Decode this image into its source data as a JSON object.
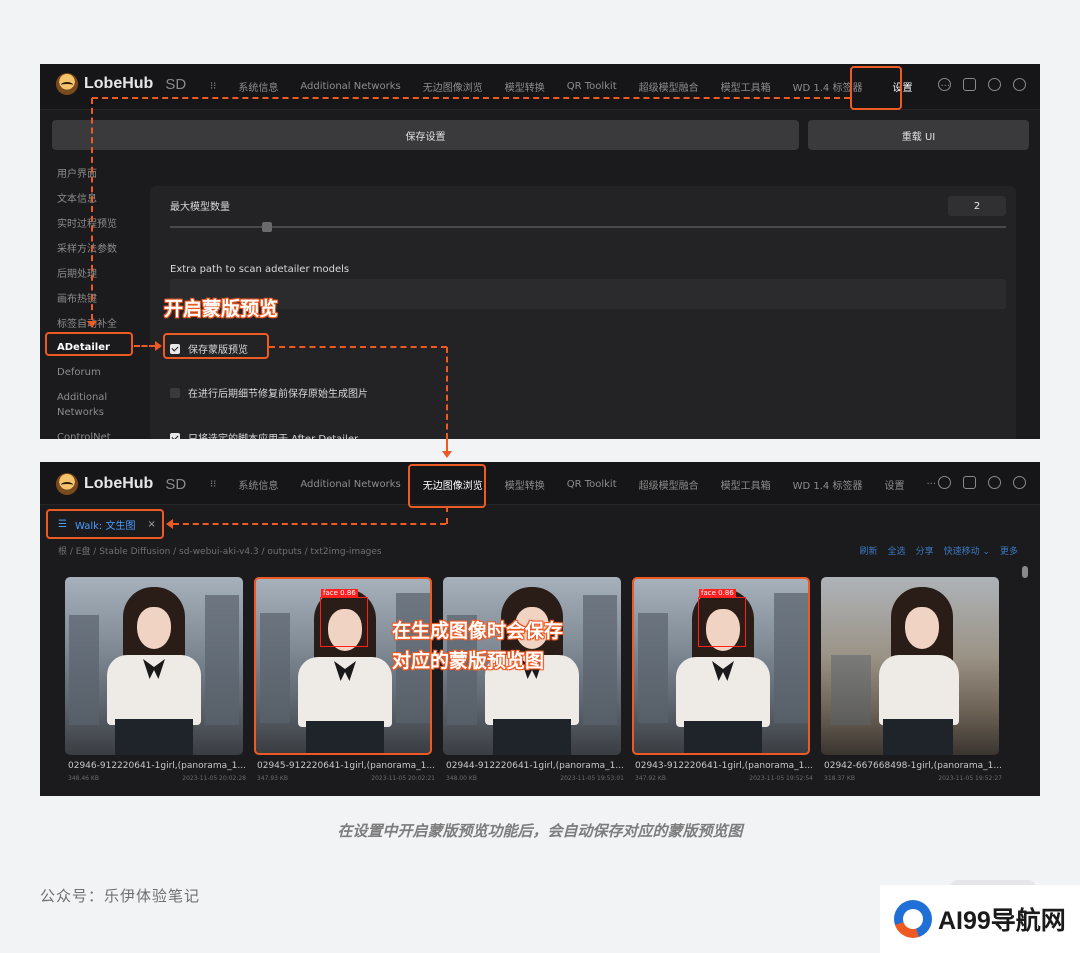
{
  "app": {
    "brand": "LobeHub",
    "brand_suffix": "SD"
  },
  "shot1": {
    "nav_tabs": [
      "⁝⁝",
      "系统信息",
      "Additional Networks",
      "无边图像浏览",
      "模型转换",
      "QR Toolkit",
      "超级模型融合",
      "模型工具箱",
      "WD 1.4 标签器",
      "设置",
      "···"
    ],
    "save_button": "保存设置",
    "reload_button": "重载 UI",
    "sidebar": [
      "用户界面",
      "文本信息",
      "实时过程预览",
      "采样方法参数",
      "后期处理",
      "画布热键",
      "标签自动补全",
      "ADetailer",
      "Deforum",
      "Additional Networks",
      "ControlNet"
    ],
    "max_models_label": "最大模型数量",
    "max_models_value": "2",
    "slider_value": 2,
    "extra_path_label": "Extra path to scan adetailer models",
    "checkboxes": [
      {
        "label": "保存蒙版预览",
        "checked": true
      },
      {
        "label": "在进行后期细节修复前保存原始生成图片",
        "checked": false
      },
      {
        "label": "只将选定的脚本应用于 After Detailer",
        "checked": true
      }
    ],
    "annotation": "开启蒙版预览"
  },
  "shot2": {
    "nav_tabs": [
      "⁝⁝",
      "系统信息",
      "Additional Networks",
      "无边图像浏览",
      "模型转换",
      "QR Toolkit",
      "超级模型融合",
      "模型工具箱",
      "WD 1.4 标签器",
      "设置",
      "···"
    ],
    "walk_tab": "Walk: 文生图",
    "walk_close": "×",
    "breadcrumb": "根 / E盘 / Stable Diffusion / sd-webui-aki-v4.3 / outputs / txt2img-images",
    "actions": [
      "刷新",
      "全选",
      "分享",
      "快速移动 ⌄",
      "更多"
    ],
    "images": [
      {
        "name": "02946-912220641-1girl,(panorama_1...",
        "size": "348.46 KB",
        "date": "2023-11-05 20:02:28",
        "face": "",
        "highlight": false
      },
      {
        "name": "02945-912220641-1girl,(panorama_1...",
        "size": "347.93 KB",
        "date": "2023-11-05 20:02:21",
        "face": "face 0.86",
        "highlight": true
      },
      {
        "name": "02944-912220641-1girl,(panorama_1...",
        "size": "348.00 KB",
        "date": "2023-11-05 19:53:01",
        "face": "",
        "highlight": false
      },
      {
        "name": "02943-912220641-1girl,(panorama_1...",
        "size": "347.92 KB",
        "date": "2023-11-05 19:52:54",
        "face": "face 0.86",
        "highlight": true
      },
      {
        "name": "02942-667668498-1girl,(panorama_1...",
        "size": "318.37 KB",
        "date": "2023-11-05 19:52:27",
        "face": "",
        "highlight": false
      }
    ],
    "annotation_line1": "在生成图像时会保存",
    "annotation_line2": "对应的蒙版预览图"
  },
  "caption": "在设置中开启蒙版预览功能后，会自动保存对应的蒙版预览图",
  "footer": "公众号：乐伊体验笔记",
  "watermark": "AI99导航网",
  "colors": {
    "accent": "#ee5a24",
    "link": "#4a9dff",
    "bg_dark": "#1b1b1d"
  }
}
